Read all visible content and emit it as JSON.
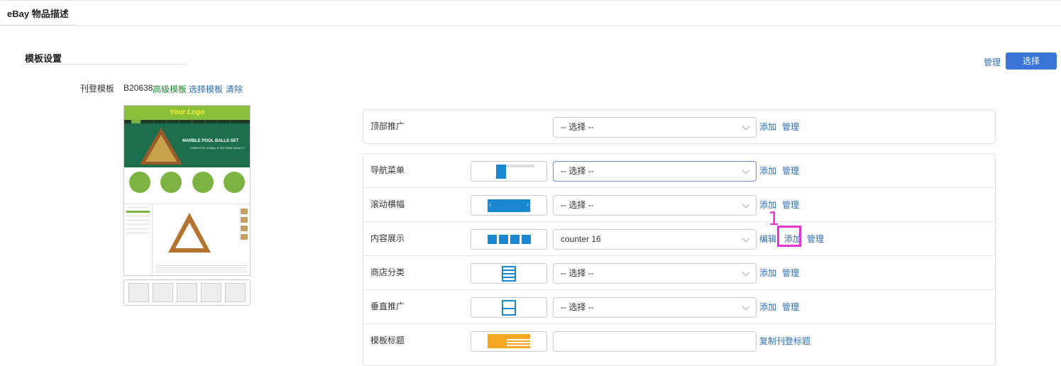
{
  "header": {
    "tab_title": "eBay 物品描述"
  },
  "template": {
    "section_title": "模板设置",
    "manage_label": "管理",
    "select_label": "选择",
    "listing_template_label": "刊登模板",
    "code": "B20638",
    "type": "高级模板",
    "choose_link": "选择模板",
    "clear_link": "清除",
    "preview": {
      "logo": "Your Logo",
      "banner_title": "MARBLE POOL BALLS SET",
      "banner_sub": "COMPLETE 16 BALLS SET RAW QUALITY"
    }
  },
  "rows": {
    "top_promo": {
      "label": "顶部推广",
      "value": "-- 选择 --",
      "add": "添加",
      "manage": "管理"
    },
    "nav_menu": {
      "label": "导航菜单",
      "value": "-- 选择 --",
      "add": "添加",
      "manage": "管理"
    },
    "scroll_banner": {
      "label": "滚动横幅",
      "value": "-- 选择 --",
      "add": "添加",
      "manage": "管理",
      "prev": "‹",
      "next": "›"
    },
    "content_display": {
      "label": "内容展示",
      "value": "counter 16",
      "edit": "编辑",
      "add": "添加",
      "manage": "管理"
    },
    "shop_category": {
      "label": "商店分类",
      "value": "-- 选择 --",
      "add": "添加",
      "manage": "管理"
    },
    "vertical_promo": {
      "label": "垂直推广",
      "value": "-- 选择 --",
      "add": "添加",
      "manage": "管理"
    },
    "template_title": {
      "label": "模板标题",
      "value": "",
      "copy": "复制刊登标题"
    }
  },
  "annotation": {
    "number": "1"
  },
  "colors": {
    "accent": "#3a74d6",
    "link": "#2f6db5",
    "highlight": "#e633d6",
    "advanced": "#1d8a2e"
  }
}
